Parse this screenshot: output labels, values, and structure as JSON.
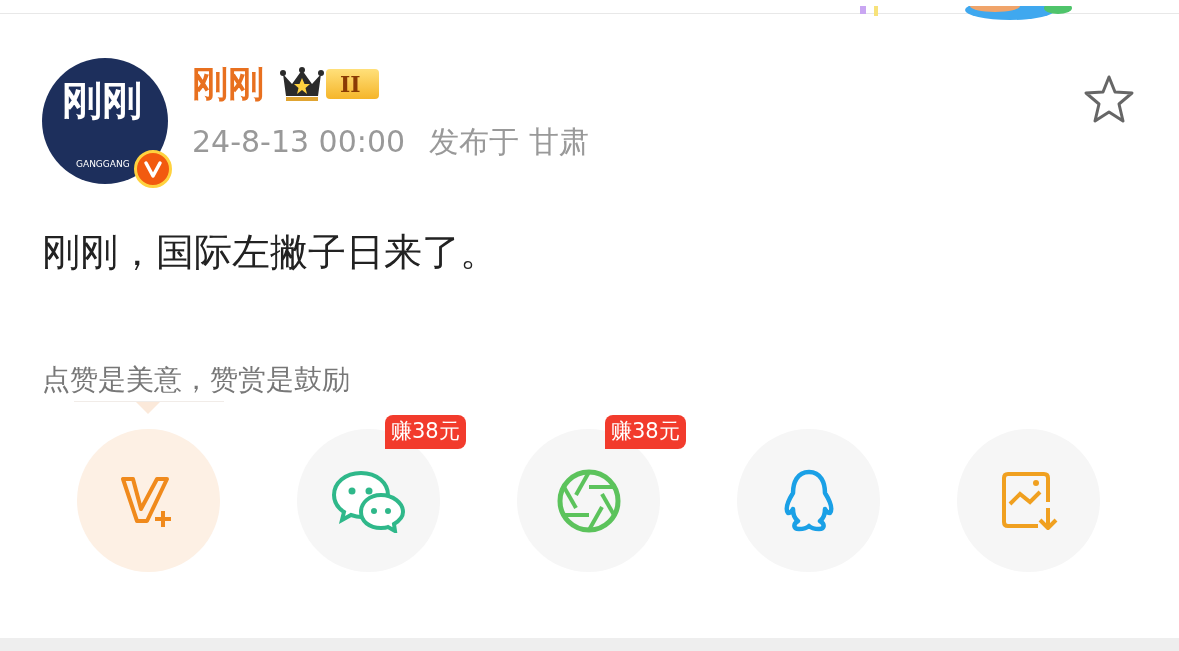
{
  "avatar": {
    "text": "刚刚",
    "subtext": "GANGGANG",
    "verified": true
  },
  "author": {
    "name": "刚刚",
    "level": "II"
  },
  "meta": {
    "time": "24-8-13 00:00",
    "location": "发布于 甘肃"
  },
  "favorite": {
    "starred": false
  },
  "post": {
    "text": "刚刚，国际左撇子日来了。"
  },
  "hint": {
    "text": "点赞是美意，赞赏是鼓励"
  },
  "share_buttons": [
    {
      "kind": "vplus",
      "highlighted": true
    },
    {
      "kind": "wechat",
      "highlighted": false,
      "badge": "赚38元"
    },
    {
      "kind": "moments",
      "highlighted": false,
      "badge": "赚38元"
    },
    {
      "kind": "qq",
      "highlighted": false
    },
    {
      "kind": "save_image",
      "highlighted": false
    }
  ]
}
